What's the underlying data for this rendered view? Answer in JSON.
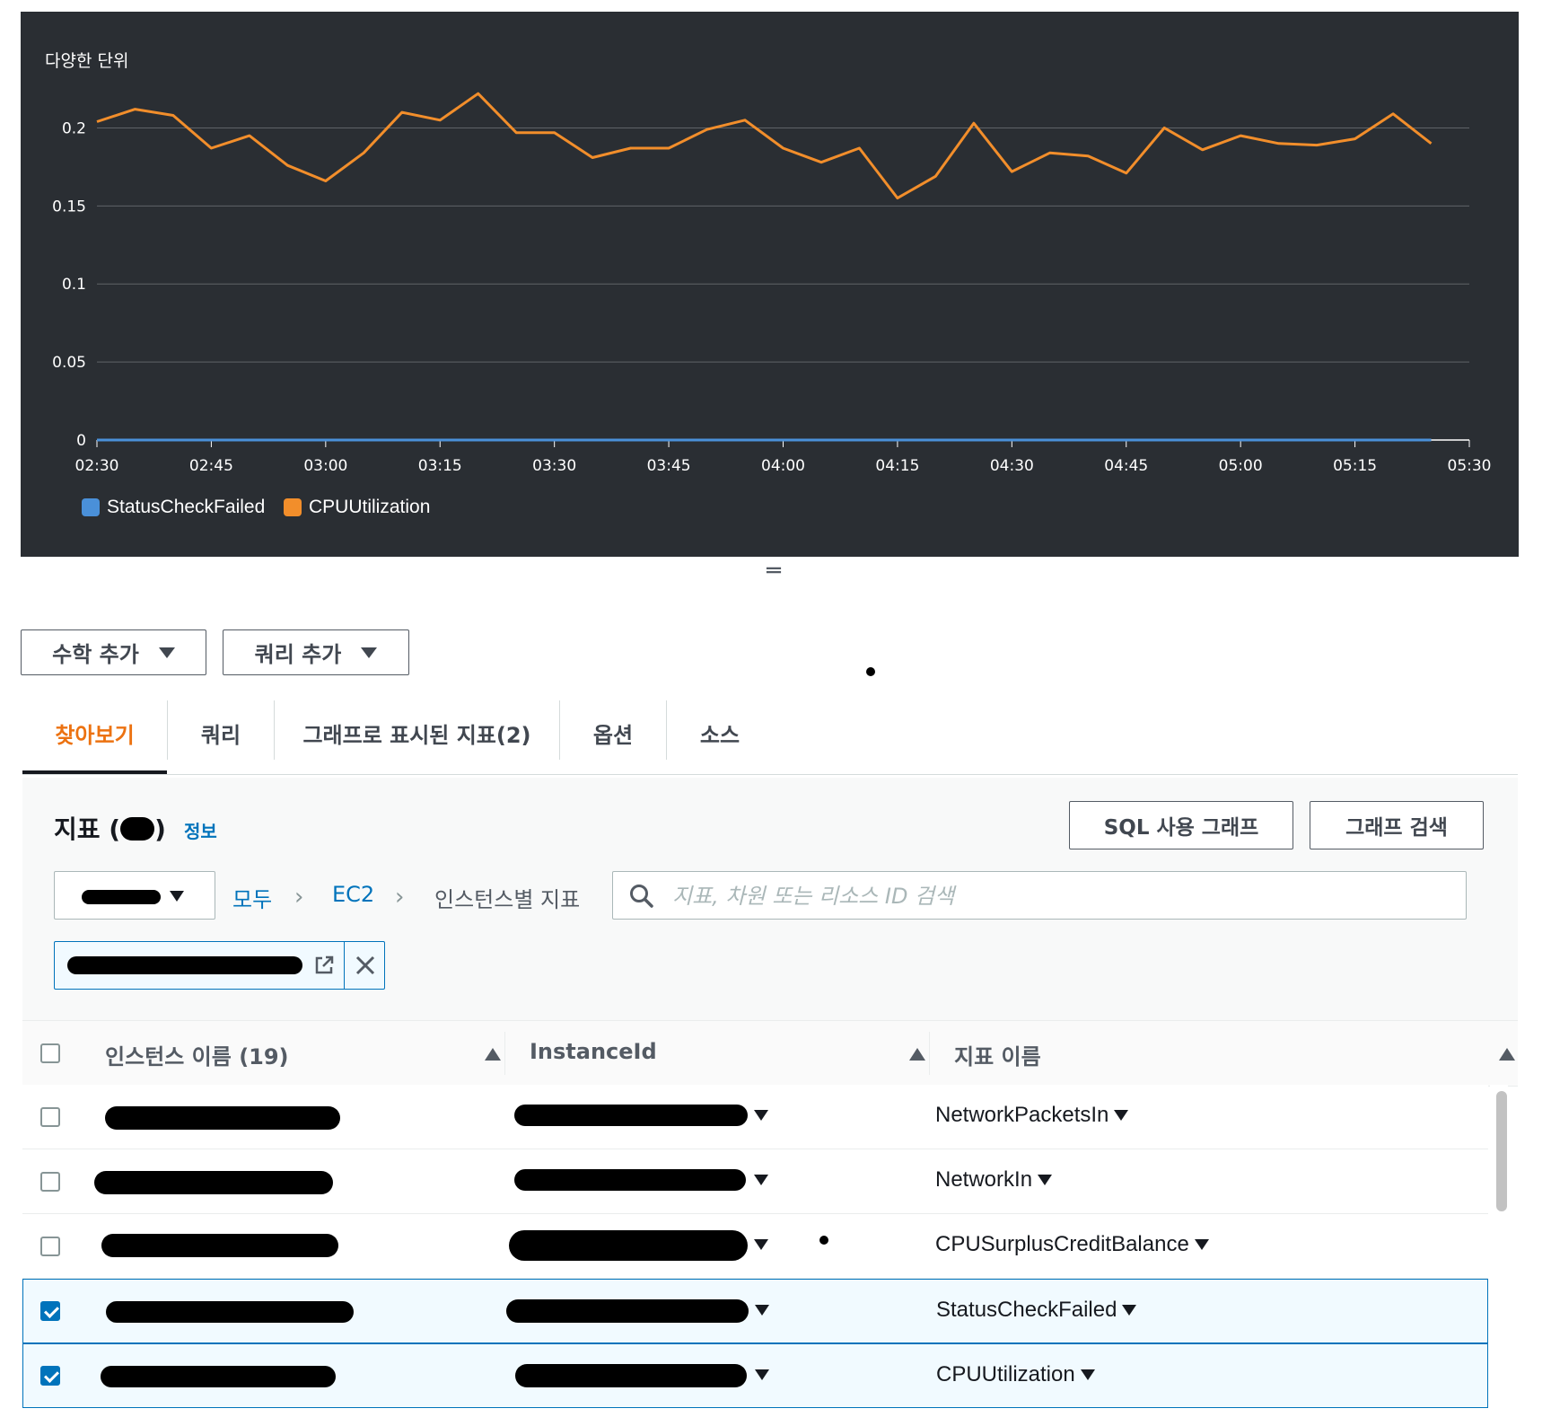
{
  "chart": {
    "title": "다양한 단위",
    "chart_data": {
      "type": "line",
      "title": "다양한 단위",
      "x": [
        "02:30",
        "02:35",
        "02:40",
        "02:45",
        "02:50",
        "02:55",
        "03:00",
        "03:05",
        "03:10",
        "03:15",
        "03:20",
        "03:25",
        "03:30",
        "03:35",
        "03:40",
        "03:45",
        "03:50",
        "03:55",
        "04:00",
        "04:05",
        "04:10",
        "04:15",
        "04:20",
        "04:25",
        "04:30",
        "04:35",
        "04:40",
        "04:45",
        "04:50",
        "04:55",
        "05:00",
        "05:05",
        "05:10",
        "05:15",
        "05:20",
        "05:25"
      ],
      "x_ticks": [
        "02:30",
        "02:45",
        "03:00",
        "03:15",
        "03:30",
        "03:45",
        "04:00",
        "04:15",
        "04:30",
        "04:45",
        "05:00",
        "05:15",
        "05:30"
      ],
      "y_ticks": [
        "0",
        "0.05",
        "0.1",
        "0.15",
        "0.2"
      ],
      "ylim": [
        0,
        0.225
      ],
      "xlim": [
        "02:30",
        "05:30"
      ],
      "series": [
        {
          "name": "StatusCheckFailed",
          "color": "#4a90d9",
          "values": [
            0,
            0,
            0,
            0,
            0,
            0,
            0,
            0,
            0,
            0,
            0,
            0,
            0,
            0,
            0,
            0,
            0,
            0,
            0,
            0,
            0,
            0,
            0,
            0,
            0,
            0,
            0,
            0,
            0,
            0,
            0,
            0,
            0,
            0,
            0,
            0
          ]
        },
        {
          "name": "CPUUtilization",
          "color": "#f28e2b",
          "values": [
            0.204,
            0.212,
            0.208,
            0.187,
            0.195,
            0.176,
            0.166,
            0.184,
            0.21,
            0.205,
            0.222,
            0.197,
            0.197,
            0.181,
            0.187,
            0.187,
            0.199,
            0.205,
            0.187,
            0.178,
            0.187,
            0.155,
            0.169,
            0.203,
            0.172,
            0.184,
            0.182,
            0.171,
            0.2,
            0.186,
            0.195,
            0.19,
            0.189,
            0.193,
            0.209,
            0.19
          ]
        }
      ],
      "grid": true,
      "legend": "bottom-left"
    }
  },
  "toolbar": {
    "math_label": "수학 추가",
    "query_label": "쿼리 추가"
  },
  "tabs": [
    {
      "label": "찾아보기",
      "active": true
    },
    {
      "label": "쿼리",
      "active": false
    },
    {
      "label": "그래프로 표시된 지표(2)",
      "active": false
    },
    {
      "label": "옵션",
      "active": false
    },
    {
      "label": "소스",
      "active": false
    }
  ],
  "metrics": {
    "title": "지표",
    "paren_open": "(",
    "paren_close": ")",
    "info": "정보",
    "sql_button": "SQL 사용 그래프",
    "search_graph_button": "그래프 검색",
    "breadcrumb": {
      "all": "모두",
      "service": "EC2",
      "current": "인스턴스별 지표"
    },
    "search_placeholder": "지표, 차원 또는 리소스 ID 검색",
    "search_value": ""
  },
  "table": {
    "headers": {
      "instance_name": "인스턴스 이름 (19)",
      "instance_id": "InstanceId",
      "metric_name": "지표 이름"
    },
    "rows": [
      {
        "metric": "NetworkPacketsIn",
        "checked": false
      },
      {
        "metric": "NetworkIn",
        "checked": false
      },
      {
        "metric": "CPUSurplusCreditBalance",
        "checked": false
      },
      {
        "metric": "StatusCheckFailed",
        "checked": true
      },
      {
        "metric": "CPUUtilization",
        "checked": true
      }
    ]
  },
  "colors": {
    "accent": "#ec7211",
    "link": "#0073bb",
    "chart_bg": "#2a2e33",
    "series_cpu": "#f28e2b",
    "series_status": "#4a90d9"
  },
  "icons": {
    "dropdown": "caret-down-icon",
    "search": "search-icon",
    "external": "external-link-icon",
    "close": "close-icon",
    "sort": "sort-ascending-icon",
    "resize": "resize-handle-icon"
  }
}
